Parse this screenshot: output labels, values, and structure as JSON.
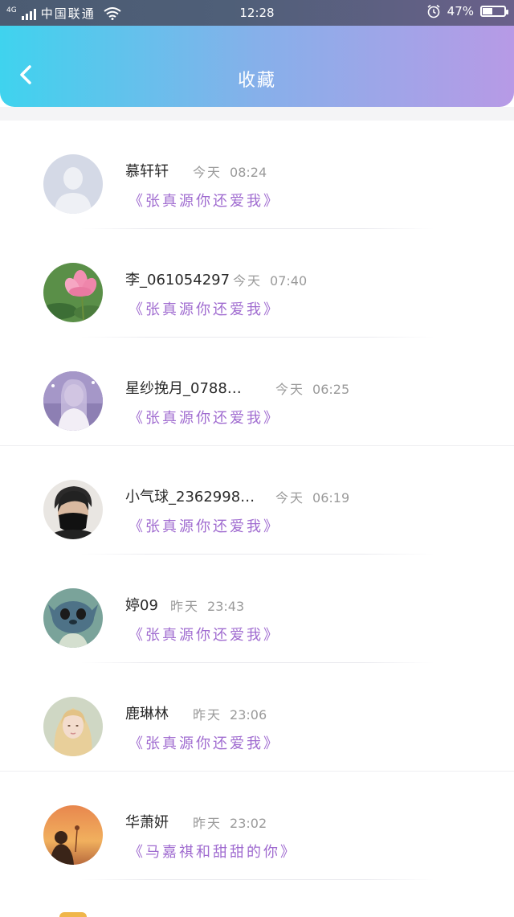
{
  "status_bar": {
    "network": "4G",
    "carrier": "中国联通",
    "time": "12:28",
    "battery_percent": "47%",
    "battery_level": 0.47
  },
  "header": {
    "title": "收藏"
  },
  "items": [
    {
      "name": "慕轩轩",
      "day": "今天",
      "time": "08:24",
      "song": "《张真源你还爱我》",
      "avatar": "default-user"
    },
    {
      "name": "李_061054297",
      "day": "今天",
      "time": "07:40",
      "song": "《张真源你还爱我》",
      "avatar": "lotus"
    },
    {
      "name": "星纱挽月_0788…",
      "day": "今天",
      "time": "06:25",
      "song": "《张真源你还爱我》",
      "avatar": "girl-purple"
    },
    {
      "name": "小气球_2362998…",
      "day": "今天",
      "time": "06:19",
      "song": "《张真源你还爱我》",
      "avatar": "boy-mask"
    },
    {
      "name": "婷09",
      "day": "昨天",
      "time": "23:43",
      "song": "《张真源你还爱我》",
      "avatar": "stitch"
    },
    {
      "name": "鹿琳林",
      "day": "昨天",
      "time": "23:06",
      "song": "《张真源你还爱我》",
      "avatar": "girl-blonde"
    },
    {
      "name": "华萧妍",
      "day": "昨天",
      "time": "23:02",
      "song": "《马嘉祺和甜甜的你》",
      "avatar": "sunset-silhouette"
    }
  ],
  "colors": {
    "song": "#a06cd0",
    "header_start": "#3fd3ee",
    "header_end": "#b79ae6"
  }
}
